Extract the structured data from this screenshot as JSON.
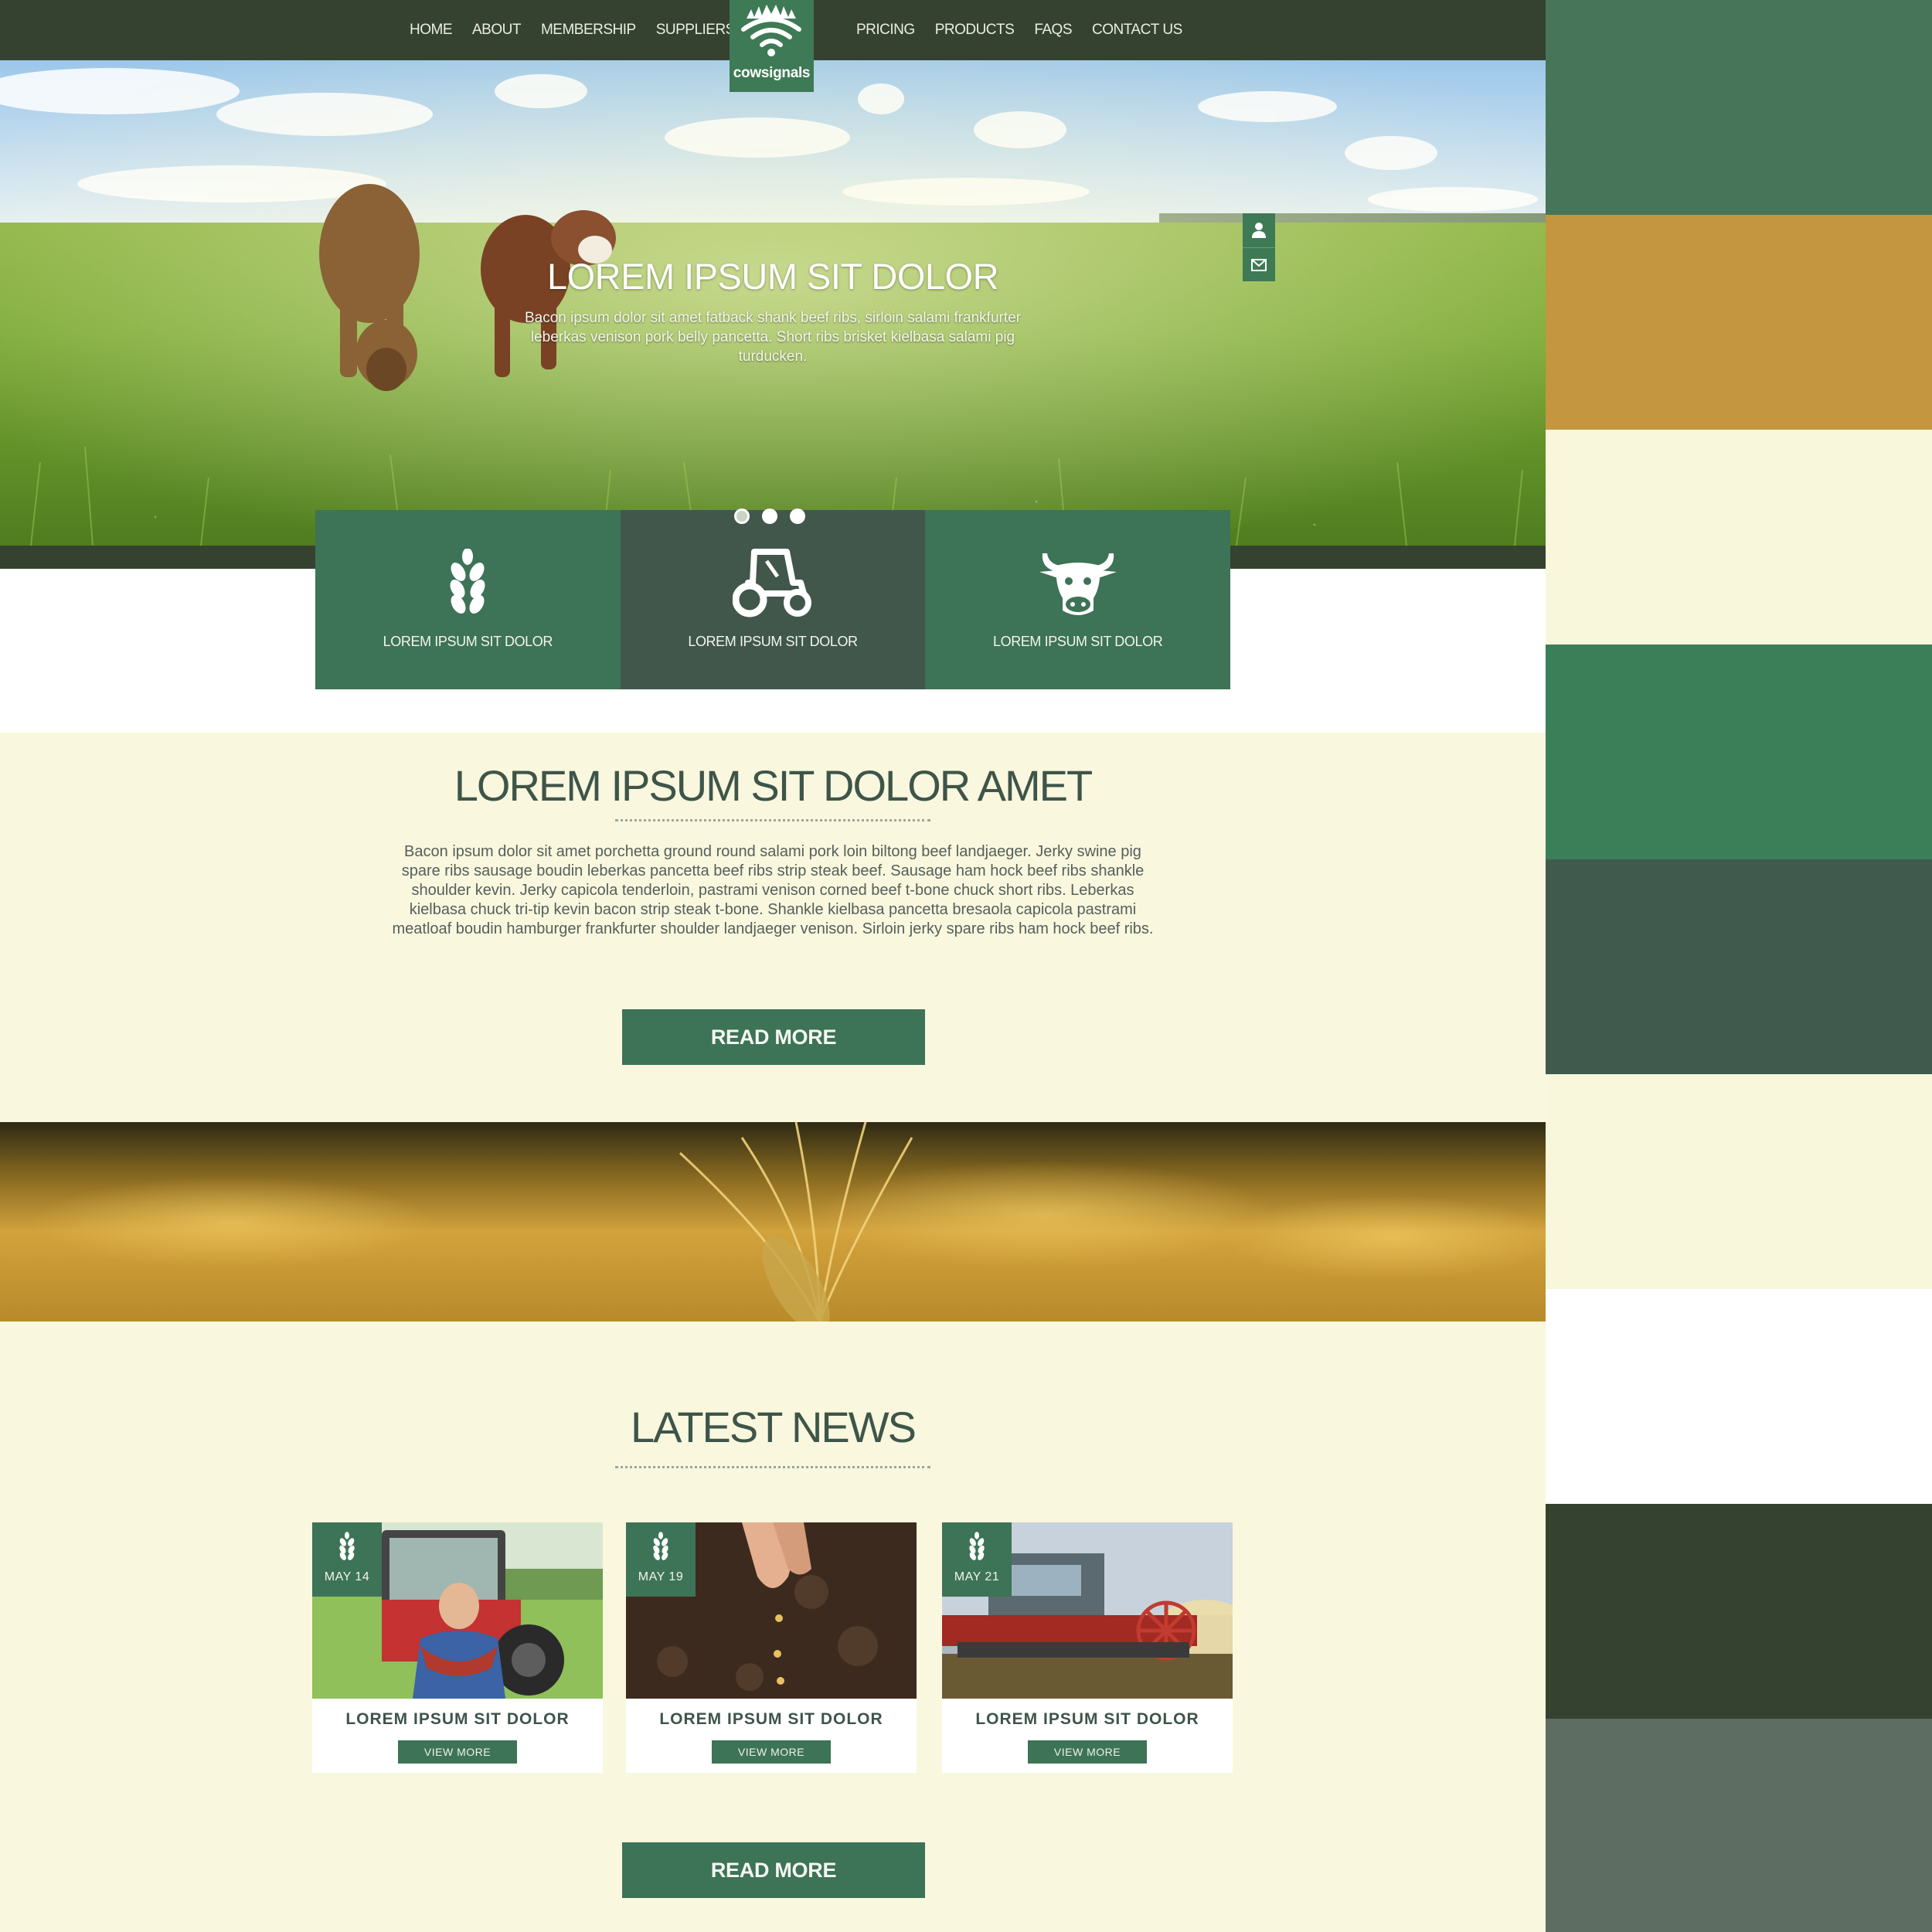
{
  "nav": {
    "left": [
      "HOME",
      "ABOUT",
      "MEMBERSHIP",
      "SUPPLIERS"
    ],
    "right": [
      "PRICING",
      "PRODUCTS",
      "FAQS",
      "CONTACT US"
    ],
    "logo_text": "cowsignals"
  },
  "hero": {
    "title": "LOREM IPSUM SIT DOLOR",
    "body": "Bacon ipsum dolor sit amet fatback shank beef ribs, sirloin salami frankfurter leberkas venison pork belly pancetta. Short ribs brisket kielbasa salami pig turducken.",
    "slides": {
      "count": 3,
      "active": 1
    },
    "side_icons": [
      "user-icon",
      "mail-icon"
    ]
  },
  "features": [
    {
      "icon": "wheat-icon",
      "label": "LOREM IPSUM SIT DOLOR"
    },
    {
      "icon": "tractor-icon",
      "label": "LOREM IPSUM SIT DOLOR"
    },
    {
      "icon": "cow-head-icon",
      "label": "LOREM IPSUM SIT DOLOR"
    }
  ],
  "about": {
    "title": "LOREM IPSUM SIT DOLOR AMET",
    "body": "Bacon ipsum dolor sit amet porchetta ground round salami pork loin biltong beef landjaeger. Jerky swine pig spare ribs sausage boudin leberkas pancetta beef ribs strip steak beef. Sausage ham hock beef ribs shankle shoulder kevin. Jerky capicola tenderloin, pastrami venison corned beef t-bone chuck short ribs. Leberkas kielbasa chuck tri-tip kevin bacon strip steak t-bone. Shankle kielbasa pancetta bresaola capicola pastrami meatloaf boudin hamburger frankfurter shoulder landjaeger venison. Sirloin jerky spare ribs ham hock beef ribs.",
    "cta": "READ MORE"
  },
  "news": {
    "title": "LATEST NEWS",
    "cards": [
      {
        "date": "MAY 14",
        "title": "LOREM IPSUM SIT DOLOR",
        "button": "VIEW MORE"
      },
      {
        "date": "MAY 19",
        "title": "LOREM IPSUM SIT DOLOR",
        "button": "VIEW MORE"
      },
      {
        "date": "MAY 21",
        "title": "LOREM IPSUM SIT DOLOR",
        "button": "VIEW MORE"
      }
    ],
    "cta": "READ MORE"
  },
  "palette": [
    "#477559",
    "#c3963f",
    "#f8f7dc",
    "#3a7f58",
    "#405a4d",
    "#f8f7dc",
    "#ffffff",
    "#364230",
    "#5d6d61"
  ]
}
